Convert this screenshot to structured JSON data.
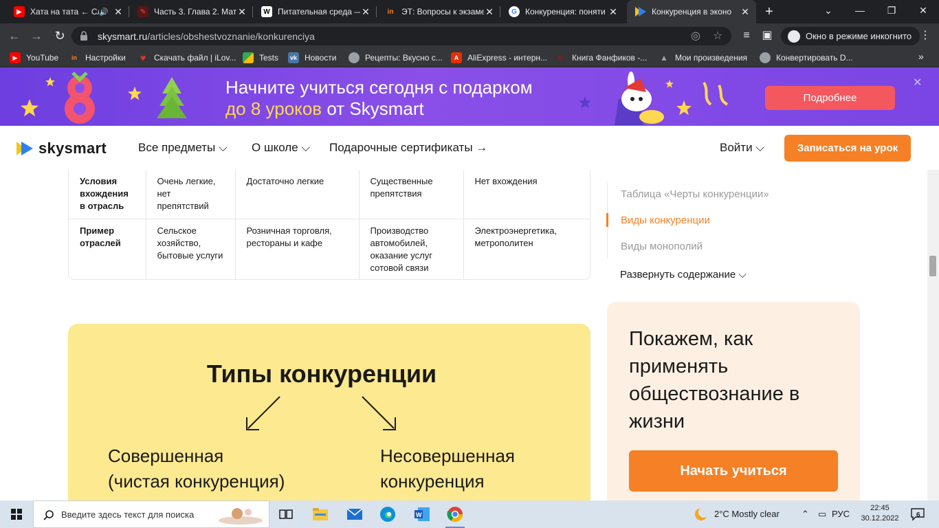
{
  "browser": {
    "tabs": [
      {
        "title": "Хата на тата ← Сл",
        "favicon": "youtube-icon",
        "audio": true
      },
      {
        "title": "Часть 3. Глава 2. Мате",
        "favicon": "book-icon"
      },
      {
        "title": "Питательная среда —",
        "favicon": "wikipedia-icon"
      },
      {
        "title": "ЭТ: Вопросы к экзаме",
        "favicon": "in-icon"
      },
      {
        "title": "Конкуренция: поняти",
        "favicon": "google-icon"
      },
      {
        "title": "Конкуренция в эконо",
        "favicon": "skysmart-icon",
        "active": true
      }
    ],
    "url_domain": "skysmart.ru",
    "url_path": "/articles/obshestvoznanie/konkurenciya",
    "incognito_label": "Окно в режиме инкогнито",
    "bookmarks": [
      {
        "label": "YouTube",
        "color": "#ff0000"
      },
      {
        "label": "Настройки",
        "color": "#f58025"
      },
      {
        "label": "Скачать файл | iLov...",
        "color": "#e5322d"
      },
      {
        "label": "Tests",
        "color": "#34a853"
      },
      {
        "label": "Новости",
        "color": "#4a76a8"
      },
      {
        "label": "Рецепты: Вкусно с...",
        "color": "#9aa0a6"
      },
      {
        "label": "AliExpress - интерн...",
        "color": "#e62e04"
      },
      {
        "label": "Книга Фанфиков -...",
        "color": "#8b1a1a"
      },
      {
        "label": "Мои произведения",
        "color": "#5f6368"
      },
      {
        "label": "Конвертировать D...",
        "color": "#9aa0a6"
      }
    ]
  },
  "banner": {
    "line1": "Начните учиться сегодня с подарком",
    "line2_accent": "до 8 уроков",
    "line2_rest": " от Skysmart",
    "button": "Подробнее",
    "accent_color": "#ffd84d"
  },
  "header": {
    "logo_text": "skysmart",
    "nav": [
      "Все предметы",
      "О школе",
      "Подарочные сертификаты"
    ],
    "login": "Войти",
    "cta": "Записаться на урок"
  },
  "table": {
    "rows": [
      {
        "header": "Условия вхождения в отрасль",
        "cells": [
          "Очень легкие, нет препятствий",
          "Достаточно легкие",
          "Существенные препятствия",
          "Нет вхождения"
        ]
      },
      {
        "header": "Пример отраслей",
        "cells": [
          "Сельское хозяйство, бытовые услуги",
          "Розничная торговля, рестораны и кафе",
          "Производство автомобилей, оказание услуг сотовой связи",
          "Электроэнергетика, метрополитен"
        ]
      }
    ]
  },
  "infographic": {
    "title": "Типы конкуренции",
    "left_line1": "Совершенная",
    "left_line2": "(чистая конкуренция)",
    "right_line1": "Несовершенная",
    "right_line2": "конкуренция"
  },
  "toc": {
    "items": [
      "Таблица «Черты конкуренции»",
      "Виды конкуренции",
      "Виды монополий"
    ],
    "active_index": 1,
    "expand": "Развернуть содержание"
  },
  "promo_card": {
    "title": "Покажем, как применять обществознание в жизни",
    "button": "Начать учиться"
  },
  "taskbar": {
    "search_placeholder": "Введите здесь текст для поиска",
    "weather": "2°C  Mostly clear",
    "language": "РУС",
    "time": "22:45",
    "date": "30.12.2022",
    "notifications": "6"
  },
  "colors": {
    "brand_orange": "#f58025",
    "banner_purple": "#7a45e4",
    "card_yellow": "#fde990",
    "card_peach": "#fdf0e3"
  }
}
